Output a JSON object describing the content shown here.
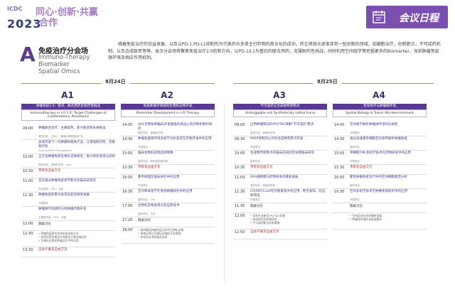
{
  "header": {
    "logo_icdc": "ICDC",
    "logo_year": "2023",
    "logo_slogan": "同心·创新·共赢·合作",
    "agenda_label": "会议日程"
  },
  "session": {
    "letter": "A",
    "title": "免疫治疗分会场",
    "en_line1": "Immuno-Therapy",
    "en_line2": "Biomarker",
    "en_line3": "Spatial Omics",
    "intro": "随着免疫治疗的日益发展，以及以PD-1,PD-L1抑制剂为代表的众多单主打药物的商业化的成功，药企将目光逐渐放到一些创新的领域，如细胞治疗，创新靶点，不可成药机制，以及合成致死等等。本次分会场将聚焦免疫治疗2.0的新方向，以PD-1/L1为基石的联合用药，克服耐药性挑战，同时利用空间组学等挖掘更多的Biomarker，深剖肿瘤免疫微环境及相应作用机制。"
  },
  "dates": {
    "day1": "8月24日",
    "day2": "8月25日"
  },
  "columns": [
    {
      "id": "A1",
      "head": "肿瘤免疫2.0：靶点、联合用药及耐药性挑战",
      "sub": "Immunotherapy in I-O 2.0: Target Challenges of Combinations, Resistance",
      "items": [
        {
          "time": "09:00",
          "title": "肿瘤联合治疗：主要趋势、新兴联合和未来挑战",
          "speaker": "嘉宾待定，主持人，董事长兼首席执行官"
        },
        {
          "time": "",
          "title": "加速开发下一代肿瘤和相关产品，以增强耐药性、克服耐药性",
          "speaker": "Turning Point Therapeutics"
        },
        {
          "time": "10:00",
          "title": "全方位肿瘤免疫生物标志物研究：助力新药发现与创新",
          "speaker": "嘉宾待定，首席科学官，Vice"
        },
        {
          "time": "10:30",
          "title": "茶歇及自由交流",
          "speaker": "",
          "kind": "break"
        },
        {
          "time": "11:00",
          "title": "首次通过肿瘤免疫调节靶点的临床前研究",
          "speaker": "待定嘉宾，CEO，待定"
        },
        {
          "time": "11:30",
          "title": "肿瘤免疫新靶点发现及新药研发进展",
          "speaker": "开放报名"
        },
        {
          "time": "",
          "title": "肿瘤微环境调控与抗肿瘤药物开发",
          "speaker": "主要研究者，CEO，总裁"
        },
        {
          "time": "12:00",
          "title": "圆桌讨论",
          "speaker": "",
          "kind": "round"
        },
        {
          "time": "12:30",
          "title": "",
          "speaker": "",
          "kind": "note",
          "note": "• 肿瘤免疫联合作用机制及新方向\n• 如何利用合理设计的联合方案克服耐药\n• 生物标志物在肿瘤治疗中的作用"
        },
        {
          "time": "13:30",
          "title": "自助午餐及自由交流",
          "speaker": "",
          "kind": "break"
        }
      ]
    },
    {
      "id": "A2",
      "head": "免疫肿瘤学领域的生物标志物开发",
      "sub": "Biomarker Development in I-O Therapy",
      "items": [
        {
          "time": "14:00",
          "title": "ADC药物早期临床开发面临的挑战以及药物机制的研究",
          "speaker": "嘉宾待定，首席医学官"
        },
        {
          "time": "14:30",
          "title": "肿瘤免疫微环境多组学分析及其在药物开发中的应用",
          "speaker": "开放报名"
        },
        {
          "time": "15:00",
          "title": "临床生物标志物选择策略",
          "speaker": "嘉宾待定，转化医学副总裁"
        },
        {
          "time": "15:30",
          "title": "茶歇及自由交流",
          "speaker": "",
          "kind": "break"
        },
        {
          "time": "16:00",
          "title": "数字病理在临床研究中的应用",
          "speaker": "开放报名"
        },
        {
          "time": "16:30",
          "title": "空间转录组学在免疫肿瘤研究中的应用",
          "speaker": "嘉宾待定，Cell"
        },
        {
          "time": "17:00",
          "title": "生物标志物发现与验证新技术",
          "speaker": "嘉宾待定，主任"
        },
        {
          "time": "17:20",
          "title": "圆桌讨论",
          "speaker": "",
          "kind": "round"
        },
        {
          "time": "18:00",
          "title": "",
          "speaker": "",
          "kind": "note",
          "note": "• 如何确定肿瘤免疫治疗的生物标志物\n• 伴随诊断与生物标志物的开发策略\n• 多组学技术的整合应用"
        }
      ]
    },
    {
      "id": "A3",
      "head": "不可成药与合成致死新靶点",
      "sub": "Undruggable and Synthetically Lethal Focus",
      "items": [
        {
          "time": "09:00",
          "title": "应用肿瘤靶向的PROTAC降解\"不可成药\"靶点",
          "speaker": "嘉宾待定，首席科学官"
        },
        {
          "time": "09:30",
          "title": "PARP抑制剂以外的合成致死靶点开发",
          "speaker": "开放报名"
        },
        {
          "time": "10:00",
          "title": "合成致死新靶点的临床前研究及早期临床研究",
          "speaker": "嘉宾待定"
        },
        {
          "time": "10:30",
          "title": "茶歇及自由交流",
          "speaker": "",
          "kind": "break"
        },
        {
          "time": "11:00",
          "title": "RAS通路靶向药物研发的最新进展",
          "speaker": "嘉宾待定，首席科学官"
        },
        {
          "time": "11:30",
          "title": "CRISPR/Cas9在药物发现中的应用：靶点发现、验证和筛选",
          "speaker": "开放报名"
        },
        {
          "time": "11:30",
          "title": "圆桌讨论",
          "speaker": "",
          "kind": "round"
        },
        {
          "time": "12:00",
          "title": "",
          "speaker": "",
          "kind": "note",
          "note": "• 如何开发新型PROTAC药物\n• 合成致死的机制研究\n• 不可成药靶点的新策略"
        },
        {
          "time": "12:50",
          "title": "自助午餐及自由交流",
          "speaker": "",
          "kind": "break"
        }
      ]
    },
    {
      "id": "A4",
      "head": "空间组学与肿瘤微环境",
      "sub": "Spatial Biology & Tumor Microenvironment",
      "items": [
        {
          "time": "14:00",
          "title": "空间组学解析肿瘤微环境的异质性",
          "speaker": "开放报名"
        },
        {
          "time": "14:30",
          "title": "通过高通量单细胞空间测序解析肿瘤免疫",
          "speaker": "嘉宾待定"
        },
        {
          "time": "15:00",
          "title": "单细胞TME多组学技术在药物研发中的应用",
          "speaker": "开放报名"
        },
        {
          "time": "15:30",
          "title": "茶歇及自由交流",
          "speaker": "",
          "kind": "break"
        },
        {
          "time": "16:00",
          "title": "聚焦肿瘤免疫治疗中的空间细胞图谱分析",
          "speaker": "嘉宾待定"
        },
        {
          "time": "16:30",
          "title": "空间多组学技术在肿瘤免疫研究中的应用",
          "speaker": "开放报名"
        },
        {
          "time": "",
          "title": "圆桌讨论",
          "speaker": "",
          "kind": "round"
        },
        {
          "time": "",
          "title": "",
          "speaker": "",
          "kind": "note",
          "note": "• 空间组学技术的最新进展\n• 肿瘤微环境的多维度解析"
        }
      ]
    }
  ]
}
